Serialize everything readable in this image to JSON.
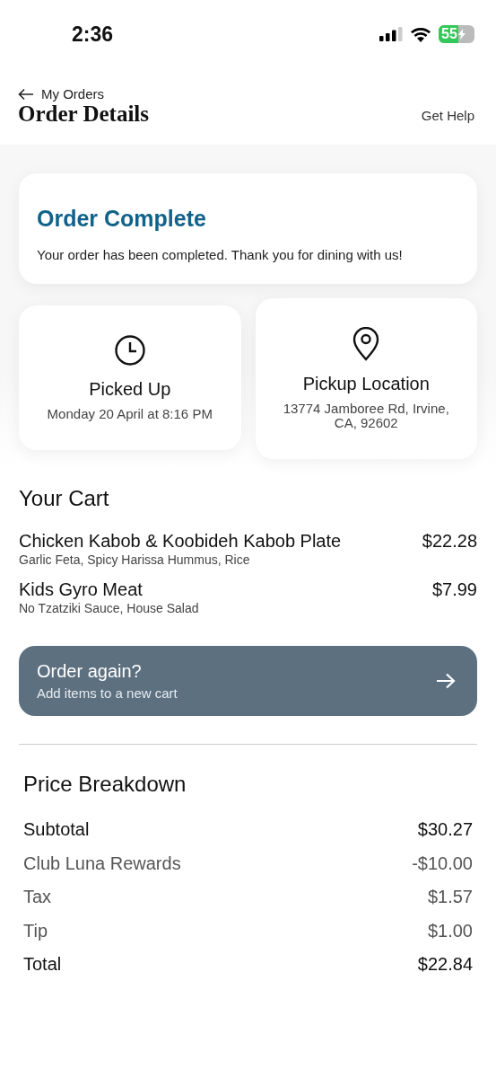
{
  "status_bar": {
    "time": "2:36",
    "battery": "55"
  },
  "header": {
    "back_label": "My Orders",
    "title": "Order Details",
    "help": "Get Help"
  },
  "status_card": {
    "title": "Order Complete",
    "message": "Your order has been completed. Thank you for dining with us!"
  },
  "info_cards": [
    {
      "kind": "clock",
      "title": "Picked Up",
      "detail": "Monday 20 April at 8:16 PM"
    },
    {
      "kind": "pin",
      "title": "Pickup Location",
      "detail": "13774 Jamboree Rd, Irvine, CA, 92602"
    }
  ],
  "cart": {
    "title": "Your Cart",
    "items": [
      {
        "name": "Chicken Kabob & Koobideh Kabob Plate",
        "options": "Garlic Feta, Spicy Harissa Hummus, Rice",
        "price": "$22.28"
      },
      {
        "name": "Kids Gyro Meat",
        "options": "No Tzatziki Sauce, House Salad",
        "price": "$7.99"
      }
    ]
  },
  "reorder": {
    "title": "Order again?",
    "subtitle": "Add items to a new cart"
  },
  "price_breakdown": {
    "title": "Price Breakdown",
    "rows": [
      {
        "kind": "major",
        "label": "Subtotal",
        "value": "$30.27"
      },
      {
        "kind": "minor",
        "label": "Club Luna Rewards",
        "value": "-$10.00"
      },
      {
        "kind": "minor",
        "label": "Tax",
        "value": "$1.57"
      },
      {
        "kind": "minor",
        "label": "Tip",
        "value": "$1.00"
      },
      {
        "kind": "major",
        "label": "Total",
        "value": "$22.84"
      }
    ]
  }
}
